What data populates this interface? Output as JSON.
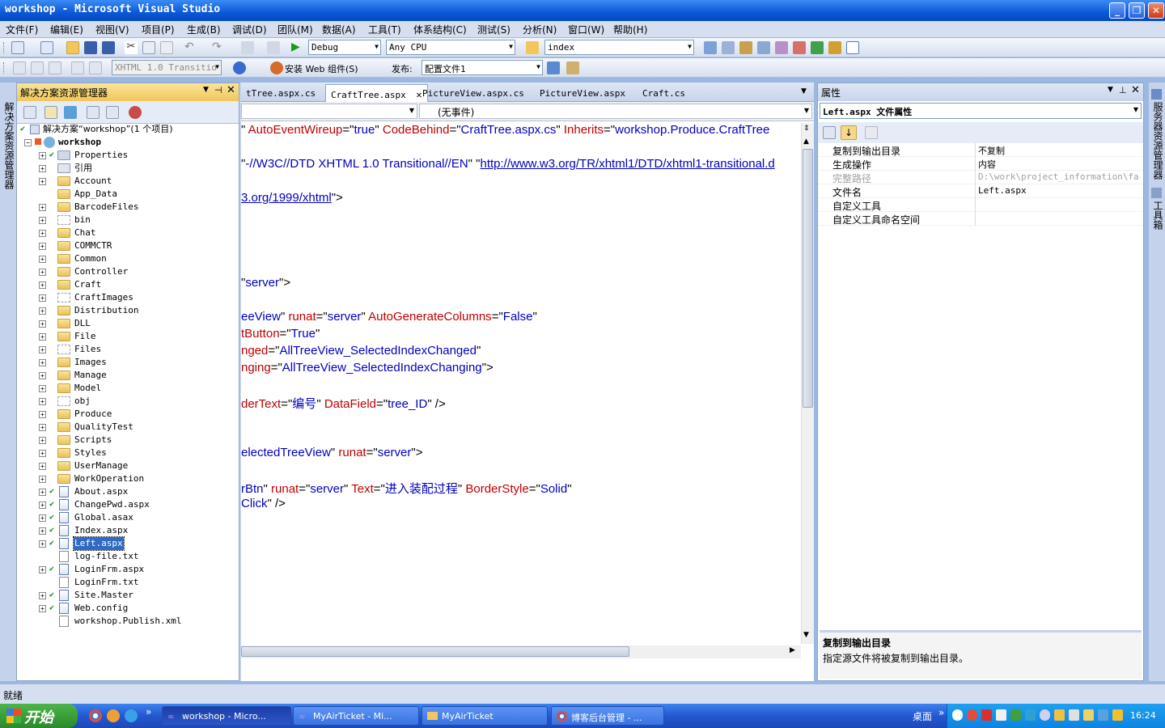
{
  "window": {
    "title": "workshop - Microsoft Visual Studio"
  },
  "menu": [
    "文件(F)",
    "编辑(E)",
    "视图(V)",
    "项目(P)",
    "生成(B)",
    "调试(D)",
    "团队(M)",
    "数据(A)",
    "工具(T)",
    "体系结构(C)",
    "测试(S)",
    "分析(N)",
    "窗口(W)",
    "帮助(H)"
  ],
  "toolbar1": {
    "config": "Debug",
    "platform": "Any CPU",
    "find": "index"
  },
  "toolbar2": {
    "doctype": "XHTML 1.0 Transitio",
    "install_web": "安装 Web 组件(S)",
    "publish_label": "发布:",
    "publish_profile": "配置文件1"
  },
  "solution_explorer": {
    "title": "解决方案资源管理器",
    "solution": "解决方案“workshop”(1 个项目)",
    "project": "workshop",
    "items": [
      "Properties",
      "引用",
      "Account",
      "App_Data",
      "BarcodeFiles",
      "bin",
      "Chat",
      "COMMCTR",
      "Common",
      "Controller",
      "Craft",
      "CraftImages",
      "Distribution",
      "DLL",
      "File",
      "Files",
      "Images",
      "Manage",
      "Model",
      "obj",
      "Produce",
      "QualityTest",
      "Scripts",
      "Styles",
      "UserManage",
      "WorkOperation",
      "About.aspx",
      "ChangePwd.aspx",
      "Global.asax",
      "Index.aspx",
      "Left.aspx",
      "log-file.txt",
      "LoginFrm.aspx",
      "LoginFrm.txt",
      "Site.Master",
      "Web.config",
      "workshop.Publish.xml"
    ]
  },
  "left_strip_label": "解决方案资源管理器",
  "right_strip": {
    "server": "服务器资源管理器",
    "toolbox": "工具箱"
  },
  "tabs": [
    "tTree.aspx.cs",
    "CraftTree.aspx",
    "PictureView.aspx.cs",
    "PictureView.aspx",
    "Craft.cs"
  ],
  "editor": {
    "nav_right": "(无事件)",
    "lines": [
      {
        "segs": [
          [
            "k",
            "\" "
          ],
          [
            "r",
            "AutoEventWireup"
          ],
          [
            "k",
            "=\""
          ],
          [
            "b",
            "true"
          ],
          [
            "k",
            "\" "
          ],
          [
            "r",
            "CodeBehind"
          ],
          [
            "k",
            "=\""
          ],
          [
            "b",
            "CraftTree.aspx.cs"
          ],
          [
            "k",
            "\" "
          ],
          [
            "r",
            "Inherits"
          ],
          [
            "k",
            "=\""
          ],
          [
            "b",
            "workshop.Produce.CraftTree"
          ]
        ]
      },
      {
        "segs": [
          [
            "k",
            "\""
          ],
          [
            "b",
            "-//W3C//DTD XHTML 1.0 Transitional//EN"
          ],
          [
            "k",
            "\" \""
          ],
          [
            "u",
            "http://www.w3.org/TR/xhtml1/DTD/xhtml1-transitional.d"
          ]
        ]
      },
      {
        "segs": [
          [
            "u",
            "3.org/1999/xhtml"
          ],
          [
            "k",
            "\">"
          ]
        ]
      },
      {
        "segs": [
          [
            "k",
            "\""
          ],
          [
            "b",
            "server"
          ],
          [
            "k",
            "\">"
          ]
        ]
      },
      {
        "segs": [
          [
            "b",
            "eeView"
          ],
          [
            "k",
            "\" "
          ],
          [
            "r",
            "runat"
          ],
          [
            "k",
            "=\""
          ],
          [
            "b",
            "server"
          ],
          [
            "k",
            "\" "
          ],
          [
            "r",
            "AutoGenerateColumns"
          ],
          [
            "k",
            "=\""
          ],
          [
            "b",
            "False"
          ],
          [
            "k",
            "\""
          ]
        ]
      },
      {
        "segs": [
          [
            "r",
            "tButton"
          ],
          [
            "k",
            "=\""
          ],
          [
            "b",
            "True"
          ],
          [
            "k",
            "\""
          ]
        ]
      },
      {
        "segs": [
          [
            "r",
            "nged"
          ],
          [
            "k",
            "=\""
          ],
          [
            "b",
            "AllTreeView_SelectedIndexChanged"
          ],
          [
            "k",
            "\""
          ]
        ]
      },
      {
        "segs": [
          [
            "r",
            "nging"
          ],
          [
            "k",
            "=\""
          ],
          [
            "b",
            "AllTreeView_SelectedIndexChanging"
          ],
          [
            "k",
            "\">"
          ]
        ]
      },
      {
        "segs": [
          [
            "r",
            "derText"
          ],
          [
            "k",
            "=\""
          ],
          [
            "b",
            "编号"
          ],
          [
            "k",
            "\" "
          ],
          [
            "r",
            "DataField"
          ],
          [
            "k",
            "=\""
          ],
          [
            "b",
            "tree_ID"
          ],
          [
            "k",
            "\" />"
          ]
        ]
      },
      {
        "segs": [
          [
            "b",
            "electedTreeView"
          ],
          [
            "k",
            "\" "
          ],
          [
            "r",
            "runat"
          ],
          [
            "k",
            "=\""
          ],
          [
            "b",
            "server"
          ],
          [
            "k",
            "\">"
          ]
        ]
      },
      {
        "segs": [
          [
            "b",
            "rBtn"
          ],
          [
            "k",
            "\" "
          ],
          [
            "r",
            "runat"
          ],
          [
            "k",
            "=\""
          ],
          [
            "b",
            "server"
          ],
          [
            "k",
            "\" "
          ],
          [
            "r",
            "Text"
          ],
          [
            "k",
            "=\""
          ],
          [
            "b",
            "进入装配过程"
          ],
          [
            "k",
            "\" "
          ],
          [
            "r",
            "BorderStyle"
          ],
          [
            "k",
            "=\""
          ],
          [
            "b",
            "Solid"
          ],
          [
            "k",
            "\""
          ]
        ]
      },
      {
        "segs": [
          [
            "b",
            "Click"
          ],
          [
            "k",
            "\" />"
          ]
        ]
      }
    ]
  },
  "properties": {
    "title": "属性",
    "selector": "Left.aspx 文件属性",
    "rows": [
      {
        "name": "复制到输出目录",
        "value": "不复制",
        "disabled": false
      },
      {
        "name": "生成操作",
        "value": "内容",
        "disabled": false
      },
      {
        "name": "完整路径",
        "value": "D:\\work\\project_information\\factor",
        "disabled": true
      },
      {
        "name": "文件名",
        "value": "Left.aspx",
        "disabled": false
      },
      {
        "name": "自定义工具",
        "value": "",
        "disabled": false
      },
      {
        "name": "自定义工具命名空间",
        "value": "",
        "disabled": false
      }
    ],
    "desc_title": "复制到输出目录",
    "desc_text": "指定源文件将被复制到输出目录。"
  },
  "status": "就绪",
  "taskbar": {
    "start": "开始",
    "tasks": [
      "workshop - Micro...",
      "MyAirTicket - Mi...",
      "MyAirTicket",
      "博客后台管理 - ..."
    ],
    "desktop": "桌面",
    "clock": "16:24"
  }
}
